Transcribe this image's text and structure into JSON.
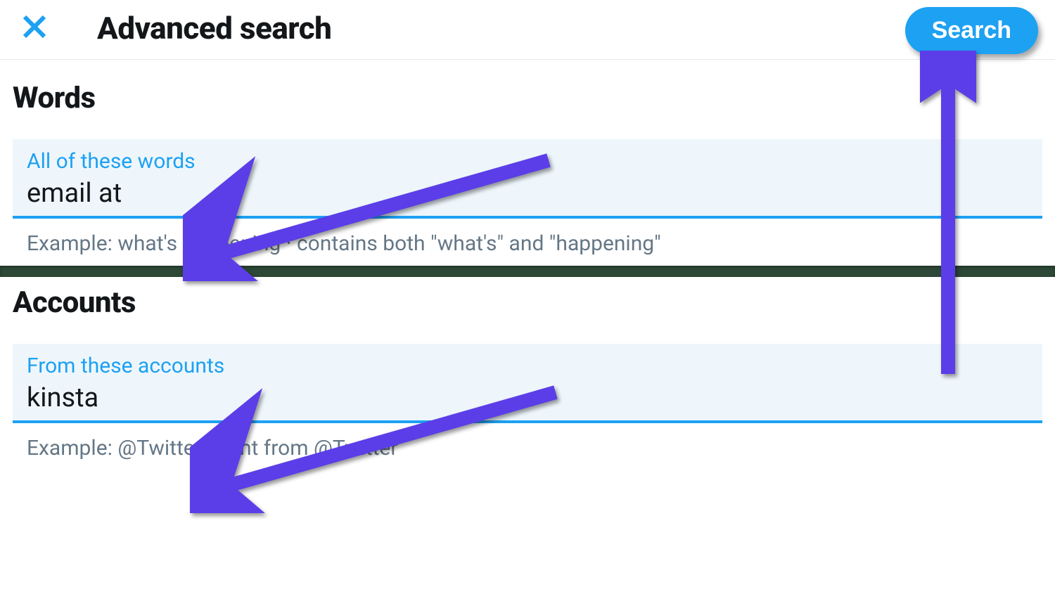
{
  "header": {
    "title": "Advanced search",
    "search_button": "Search"
  },
  "sections": {
    "words": {
      "title": "Words",
      "field_label": "All of these words",
      "field_value": "email at",
      "example": "Example: what's happening · contains both \"what's\" and \"happening\""
    },
    "accounts": {
      "title": "Accounts",
      "field_label": "From these accounts",
      "field_value": "kinsta",
      "example": "Example: @Twitter · sent from @Twitter"
    }
  },
  "colors": {
    "accent": "#1da1f2",
    "annotation": "#5b3ee8",
    "text_primary": "#14171a",
    "text_secondary": "#657786",
    "field_bg": "#eef6fb"
  }
}
